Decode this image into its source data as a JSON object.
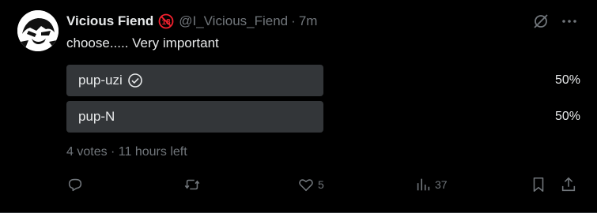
{
  "author": {
    "display_name": "Vicious Fiend",
    "handle": "@I_Vicious_Fiend",
    "separator": "·",
    "time": "7m",
    "badge": "age-18-icon"
  },
  "post": {
    "text": "choose..... Very important"
  },
  "poll": {
    "options": [
      {
        "label": "pup-uzi",
        "percent": "50%",
        "fill_fraction": 0.5,
        "voted": true
      },
      {
        "label": "pup-N",
        "percent": "50%",
        "fill_fraction": 0.5,
        "voted": false
      }
    ],
    "summary": "4 votes · 11 hours left"
  },
  "actions": {
    "replies": "",
    "reposts": "",
    "likes": "5",
    "views": "37"
  },
  "colors": {
    "background": "#000000",
    "text": "#e7e9ea",
    "muted": "#71767b",
    "poll_bar": "#333639",
    "badge_red": "#f4212e"
  }
}
